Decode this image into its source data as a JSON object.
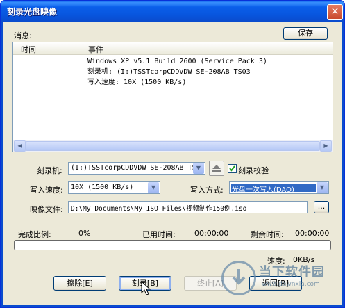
{
  "window": {
    "title": "刻录光盘映像",
    "close_glyph": "✕"
  },
  "messages": {
    "label": "消息:",
    "save_label": "保存",
    "columns": [
      "时间",
      "事件"
    ],
    "lines": [
      "Windows XP v5.1 Build 2600 (Service Pack 3)",
      "刻录机:  (I:)TSSTcorpCDDVDW SE-208AB TS03",
      "写入速度: 10X (1500 KB/s)"
    ]
  },
  "settings": {
    "burner_label": "刻录机:",
    "burner_value": "(I:)TSSTcorpCDDVDW SE-208AB TS03",
    "verify_label": "刻录校验",
    "verify_checked": true,
    "speed_label": "写入速度:",
    "speed_value": "10X (1500 KB/s)",
    "method_label": "写入方式:",
    "method_value": "光盘一次写入(DAO)",
    "image_label": "映像文件:",
    "image_value": "D:\\My Documents\\My ISO Files\\视频制作150例.iso",
    "browse_label": "..."
  },
  "progress": {
    "percent_label": "完成比例:",
    "percent_value": "0%",
    "elapsed_label": "已用时间:",
    "elapsed_value": "00:00:00",
    "remaining_label": "剩余时间:",
    "remaining_value": "00:00:00",
    "fraction": 0,
    "speed_label": "速度:",
    "speed_value": "0KB/s"
  },
  "buttons": {
    "erase": "擦除[E]",
    "burn": "刻录[B]",
    "stop": "终止[A]",
    "back": "返回[R]"
  },
  "watermark": {
    "name": "当下软件园",
    "url": "www.downxia.com"
  },
  "colors": {
    "title_bar": "#0a5fea",
    "selection": "#316ac5",
    "face": "#ece9d8"
  }
}
